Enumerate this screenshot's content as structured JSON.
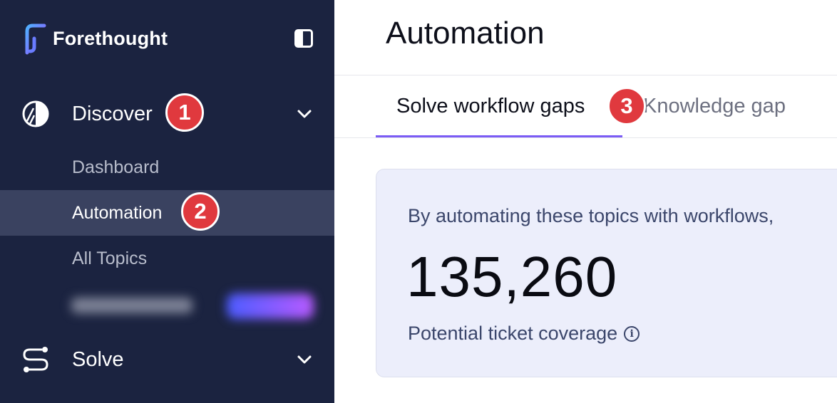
{
  "brand": {
    "name": "Forethought"
  },
  "sidebar": {
    "sections": [
      {
        "label": "Discover",
        "icon": "discover-icon",
        "expanded": true
      },
      {
        "label": "Solve",
        "icon": "solve-icon",
        "expanded": false
      }
    ],
    "discover_items": [
      {
        "label": "Dashboard",
        "active": false
      },
      {
        "label": "Automation",
        "active": true
      },
      {
        "label": "All Topics",
        "active": false
      }
    ]
  },
  "callouts": [
    "1",
    "2",
    "3"
  ],
  "main": {
    "title": "Automation",
    "tabs": [
      {
        "label": "Solve workflow gaps",
        "active": true
      },
      {
        "label": "Knowledge gap",
        "active": false
      }
    ],
    "card": {
      "description": "By automating these topics with workflows,",
      "value": "135,260",
      "caption": "Potential ticket coverage",
      "info_icon_glyph": "i"
    }
  },
  "colors": {
    "sidebar_bg": "#1b2340",
    "active_item_bg": "#3a4260",
    "callout_red": "#e0393e",
    "tab_underline": "#7b5cf5",
    "card_bg": "#eceefb"
  }
}
